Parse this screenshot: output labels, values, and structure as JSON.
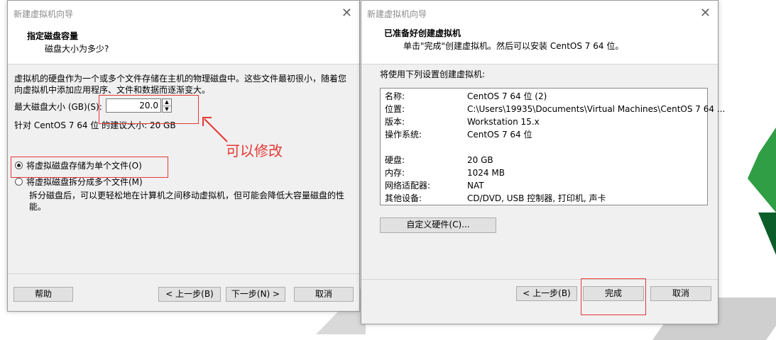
{
  "left_dialog": {
    "window_title": "新建虚拟机向导",
    "header_title": "指定磁盘容量",
    "header_subtitle": "磁盘大小为多少?",
    "desc_line1": "虚拟机的硬盘作为一个或多个文件存储在主机的物理磁盘中。这些文件最初很小，随着您",
    "desc_line2": "向虚拟机中添加应用程序、文件和数据而逐渐变大。",
    "max_size_label": "最大磁盘大小 (GB)(S):",
    "max_size_value": "20.0",
    "recommend_text": "针对 CentOS 7 64 位 的建议大小: 20 GB",
    "radio_single": "将虚拟磁盘存储为单个文件(O)",
    "radio_split": "将虚拟磁盘拆分成多个文件(M)",
    "split_desc_line1": "拆分磁盘后，可以更轻松地在计算机之间移动虚拟机，但可能会降低大容量磁盘的性",
    "split_desc_line2": "能。",
    "btn_help": "帮助",
    "btn_back": "< 上一步(B)",
    "btn_next": "下一步(N) >",
    "btn_cancel": "取消",
    "annotation": "可以修改"
  },
  "right_dialog": {
    "window_title": "新建虚拟机向导",
    "header_title": "已准备好创建虚拟机",
    "header_subtitle": "单击\"完成\"创建虚拟机。然后可以安装 CentOS 7 64 位。",
    "settings_label": "将使用下列设置创建虚拟机:",
    "rows": [
      {
        "k": "名称:",
        "v": "CentOS 7 64 位 (2)"
      },
      {
        "k": "位置:",
        "v": "C:\\Users\\19935\\Documents\\Virtual Machines\\CentOS 7 64 ..."
      },
      {
        "k": "版本:",
        "v": "Workstation 15.x"
      },
      {
        "k": "操作系统:",
        "v": "CentOS 7 64 位"
      },
      {
        "k": "硬盘:",
        "v": "20 GB"
      },
      {
        "k": "内存:",
        "v": "1024 MB"
      },
      {
        "k": "网络适配器:",
        "v": "NAT"
      },
      {
        "k": "其他设备:",
        "v": "CD/DVD, USB 控制器, 打印机, 声卡"
      }
    ],
    "btn_customize": "自定义硬件(C)...",
    "btn_back": "< 上一步(B)",
    "btn_finish": "完成",
    "btn_cancel": "取消"
  },
  "colors": {
    "annotation_red": "#e53935",
    "dialog_bg": "#f0f0f0"
  }
}
